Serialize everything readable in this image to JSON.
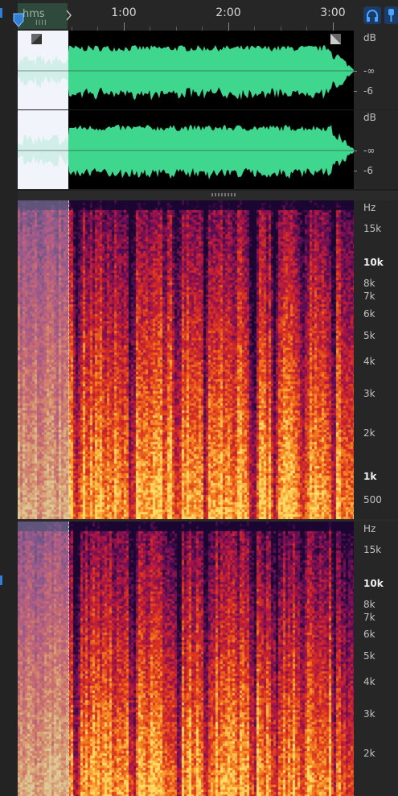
{
  "timeline": {
    "format_label": "hms",
    "format_sub": "IIII",
    "time_labels": [
      "1:00",
      "2:00",
      "3:00"
    ]
  },
  "waveform": {
    "channels": [
      {
        "scale": [
          "dB",
          "-∞",
          "-6"
        ]
      },
      {
        "scale": [
          "dB",
          "-∞",
          "-6"
        ]
      }
    ]
  },
  "spectrogram": {
    "channels": [
      {
        "scale": [
          "Hz",
          "15k",
          "10k",
          "8k",
          "7k",
          "6k",
          "5k",
          "4k",
          "3k",
          "2k",
          "1k",
          "500"
        ]
      },
      {
        "scale": [
          "Hz",
          "15k",
          "10k",
          "8k",
          "7k",
          "6k",
          "5k",
          "4k",
          "3k",
          "2k"
        ]
      }
    ]
  },
  "colors": {
    "waveform": "#3fd68e",
    "selection": "#f2f4fb",
    "accent": "#2f7fd6"
  },
  "icons": [
    "playhead-marker-icon",
    "headphones-icon",
    "pin-icon",
    "fade-in-handle-icon",
    "fade-out-handle-icon"
  ]
}
